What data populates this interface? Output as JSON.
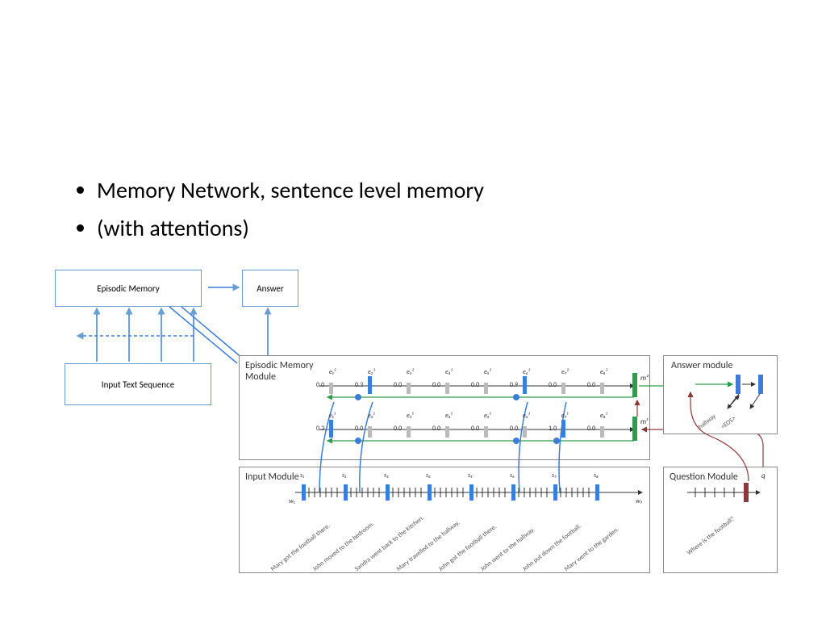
{
  "bullets": [
    "Memory Network, sentence level memory",
    "(with attentions)"
  ],
  "top_diagram": {
    "episodic_memory": "Episodic Memory",
    "answer": "Answer",
    "input_text": "Input Text Sequence"
  },
  "episodic_panel": {
    "title": "Episodic Memory\nModule",
    "row2": {
      "e_labels": [
        "e₁²",
        "e₂²",
        "e₃²",
        "e₄²",
        "e₅²",
        "e₆²",
        "e₇²",
        "e₈²"
      ],
      "values": [
        "0.0",
        "0.3",
        "0.0",
        "0.0",
        "0.0",
        "0.9",
        "0.0",
        "0.0"
      ],
      "m": "m²"
    },
    "row1": {
      "e_labels": [
        "e₁¹",
        "e₂¹",
        "e₃¹",
        "e₄¹",
        "e₅¹",
        "e₆¹",
        "e₇¹",
        "e₈¹"
      ],
      "values": [
        "0.3",
        "0.0",
        "0.0",
        "0.0",
        "0.0",
        "0.0",
        "1.0",
        "0.0"
      ],
      "m": "m¹"
    }
  },
  "input_panel": {
    "title": "Input Module",
    "s_labels": [
      "s₁",
      "s₂",
      "s₃",
      "s₄",
      "s₅",
      "s₆",
      "s₇",
      "s₈"
    ],
    "w_start": "w₁",
    "w_end": "w₇",
    "sentences": [
      "Mary got the football there.",
      "John moved to the bedroom.",
      "Sandra went back to the kitchen.",
      "Mary travelled to the hallway.",
      "John got the football there.",
      "John went to the hallway.",
      "John put down the football.",
      "Mary went to the garden."
    ]
  },
  "question_panel": {
    "title": "Question Module",
    "q": "q",
    "question": "Where is the football?"
  },
  "answer_panel": {
    "title": "Answer module",
    "outputs": [
      "hallway",
      "<EOS>"
    ]
  }
}
